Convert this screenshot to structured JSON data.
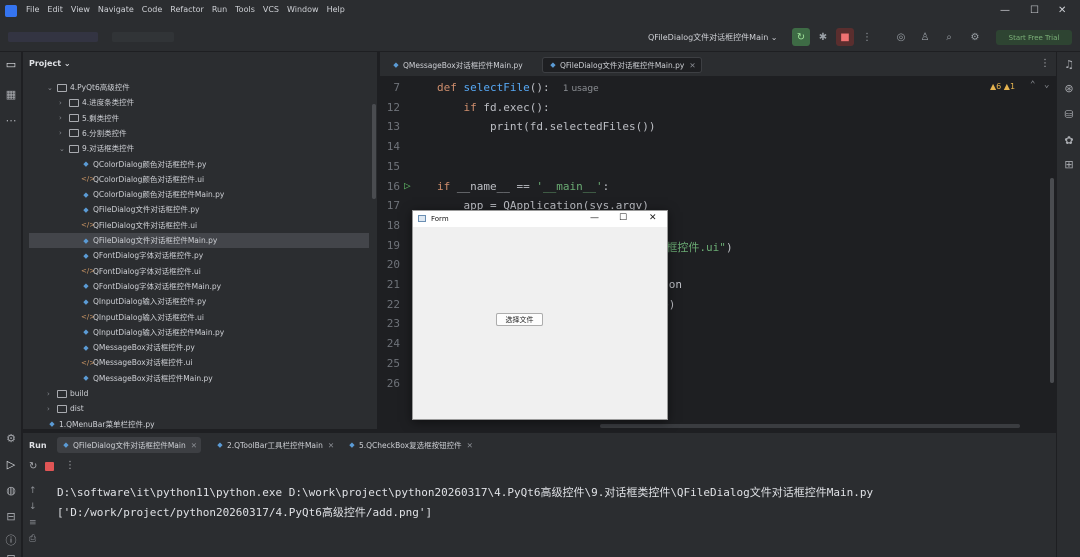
{
  "menu": [
    "File",
    "Edit",
    "View",
    "Navigate",
    "Code",
    "Refactor",
    "Run",
    "Tools",
    "VCS",
    "Window",
    "Help"
  ],
  "toolbar": {
    "run_config": "QFileDialog文件对话框控件Main",
    "start_trial": "Start Free Trial"
  },
  "project": {
    "header": "Project",
    "tree": [
      {
        "label": "4.PyQt6高级控件",
        "type": "folder",
        "expanded": true,
        "depth": 1
      },
      {
        "label": "4.进度条类控件",
        "type": "folder",
        "expanded": false,
        "depth": 2
      },
      {
        "label": "5.剩类控件",
        "type": "folder",
        "expanded": false,
        "depth": 2
      },
      {
        "label": "6.分割类控件",
        "type": "folder",
        "expanded": false,
        "depth": 2
      },
      {
        "label": "9.对话框类控件",
        "type": "folder",
        "expanded": true,
        "depth": 2
      },
      {
        "label": "QColorDialog颜色对话框控件.py",
        "type": "py",
        "depth": 3
      },
      {
        "label": "QColorDialog颜色对话框控件.ui",
        "type": "ui",
        "depth": 3
      },
      {
        "label": "QColorDialog颜色对话框控件Main.py",
        "type": "py",
        "depth": 3
      },
      {
        "label": "QFileDialog文件对话框控件.py",
        "type": "py",
        "depth": 3
      },
      {
        "label": "QFileDialog文件对话框控件.ui",
        "type": "ui",
        "depth": 3
      },
      {
        "label": "QFileDialog文件对话框控件Main.py",
        "type": "py",
        "depth": 3,
        "selected": true
      },
      {
        "label": "QFontDialog字体对话框控件.py",
        "type": "py",
        "depth": 3
      },
      {
        "label": "QFontDialog字体对话框控件.ui",
        "type": "ui",
        "depth": 3
      },
      {
        "label": "QFontDialog字体对话框控件Main.py",
        "type": "py",
        "depth": 3
      },
      {
        "label": "QInputDialog输入对话框控件.py",
        "type": "py",
        "depth": 3
      },
      {
        "label": "QInputDialog输入对话框控件.ui",
        "type": "ui",
        "depth": 3
      },
      {
        "label": "QInputDialog输入对话框控件Main.py",
        "type": "py",
        "depth": 3
      },
      {
        "label": "QMessageBox对话框控件.py",
        "type": "py",
        "depth": 3
      },
      {
        "label": "QMessageBox对话框控件.ui",
        "type": "ui",
        "depth": 3
      },
      {
        "label": "QMessageBox对话框控件Main.py",
        "type": "py",
        "depth": 3
      },
      {
        "label": "build",
        "type": "folder",
        "expanded": false,
        "depth": 1
      },
      {
        "label": "dist",
        "type": "folder",
        "expanded": false,
        "depth": 1
      },
      {
        "label": "1.QMenuBar菜单栏控件.py",
        "type": "py",
        "depth": 1
      }
    ]
  },
  "editor": {
    "tabs": [
      {
        "label": "QMessageBox对话框控件Main.py",
        "active": false
      },
      {
        "label": "QFileDialog文件对话框控件Main.py",
        "active": true
      }
    ],
    "warnings": "▲6 ▲1",
    "lines": [
      {
        "n": "7",
        "html": "<span class='kw'>def</span> <span class='fn'>selectFile</span>():  <span class='usage'>1 usage</span>"
      },
      {
        "n": "12",
        "html": "    <span class='kw'>if</span> fd.exec():"
      },
      {
        "n": "13",
        "html": "        print(fd.selectedFiles())"
      },
      {
        "n": "14",
        "html": ""
      },
      {
        "n": "15",
        "html": ""
      },
      {
        "n": "16",
        "html": "<span class='kw'>if</span> __name__ == <span class='str'>'__main__'</span>:"
      },
      {
        "n": "17",
        "html": "    app = QApplication(sys.argv)"
      },
      {
        "n": "18",
        "html": ""
      },
      {
        "n": "19",
        "html": "                            <span class='str'>文件对话框控件.ui\"</span>)"
      },
      {
        "n": "20",
        "html": ""
      },
      {
        "n": "21",
        "html": "                            ushButton"
      },
      {
        "n": "22",
        "html": "                            ectFile)"
      },
      {
        "n": "23",
        "html": ""
      },
      {
        "n": "24",
        "html": ""
      },
      {
        "n": "25",
        "html": ""
      },
      {
        "n": "26",
        "html": ""
      }
    ]
  },
  "form_window": {
    "title": "Form",
    "button_label": "选择文件"
  },
  "run": {
    "label": "Run",
    "tabs": [
      {
        "label": "QFileDialog文件对话框控件Main",
        "active": true
      },
      {
        "label": "2.QToolBar工具栏控件Main",
        "active": false
      },
      {
        "label": "5.QCheckBox复选框按钮控件",
        "active": false
      }
    ],
    "console": [
      "D:\\software\\it\\python11\\python.exe D:\\work\\project\\python20260317\\4.PyQt6高级控件\\9.对话框类控件\\QFileDialog文件对话框控件Main.py",
      "['D:/work/project/python20260317/4.PyQt6高级控件/add.png']"
    ]
  }
}
